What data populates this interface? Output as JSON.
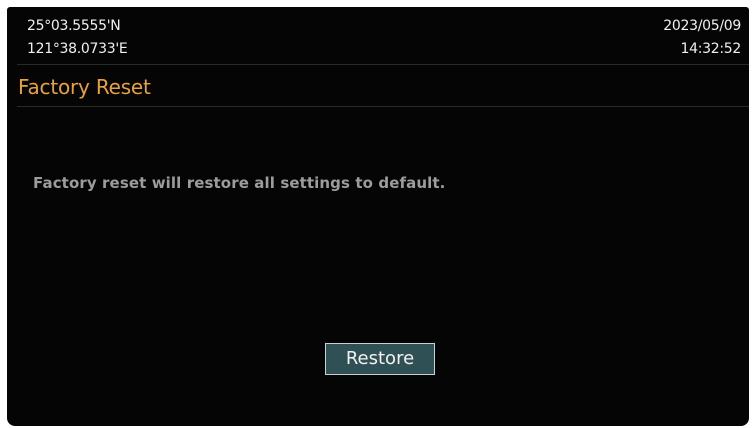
{
  "status": {
    "latitude": "25°03.5555'N",
    "longitude": "121°38.0733'E",
    "date": "2023/05/09",
    "time": "14:32:52"
  },
  "page": {
    "title": "Factory Reset",
    "message": "Factory reset will restore all settings to default."
  },
  "actions": {
    "restore_label": "Restore"
  },
  "colors": {
    "title_accent": "#e8a23a",
    "button_fill": "#2f5156",
    "background": "#050505"
  }
}
